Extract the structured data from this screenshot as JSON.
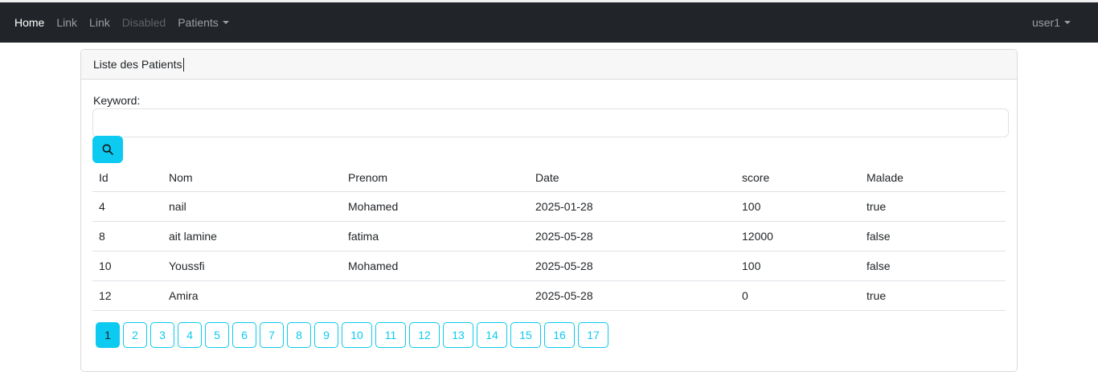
{
  "navbar": {
    "items": [
      {
        "label": "Home",
        "state": "active"
      },
      {
        "label": "Link",
        "state": "normal"
      },
      {
        "label": "Link",
        "state": "normal"
      },
      {
        "label": "Disabled",
        "state": "disabled"
      },
      {
        "label": "Patients",
        "state": "dropdown"
      }
    ],
    "user": "user1"
  },
  "card": {
    "title": "Liste des Patients",
    "keyword_label": "Keyword:",
    "keyword_value": "",
    "search_icon": "search-icon"
  },
  "table": {
    "headers": [
      "Id",
      "Nom",
      "Prenom",
      "Date",
      "score",
      "Malade"
    ],
    "rows": [
      [
        "4",
        "nail",
        "Mohamed",
        "2025-01-28",
        "100",
        "true"
      ],
      [
        "8",
        "ait lamine",
        "fatima",
        "2025-05-28",
        "12000",
        "false"
      ],
      [
        "10",
        "Youssfi",
        "Mohamed",
        "2025-05-28",
        "100",
        "false"
      ],
      [
        "12",
        "Amira",
        "",
        "2025-05-28",
        "0",
        "true"
      ]
    ]
  },
  "pagination": {
    "pages": [
      "1",
      "2",
      "3",
      "4",
      "5",
      "6",
      "7",
      "8",
      "9",
      "10",
      "11",
      "12",
      "13",
      "14",
      "15",
      "16",
      "17"
    ],
    "current": "1"
  },
  "colors": {
    "navbar": "#212529",
    "accent": "#0dcaf0"
  }
}
